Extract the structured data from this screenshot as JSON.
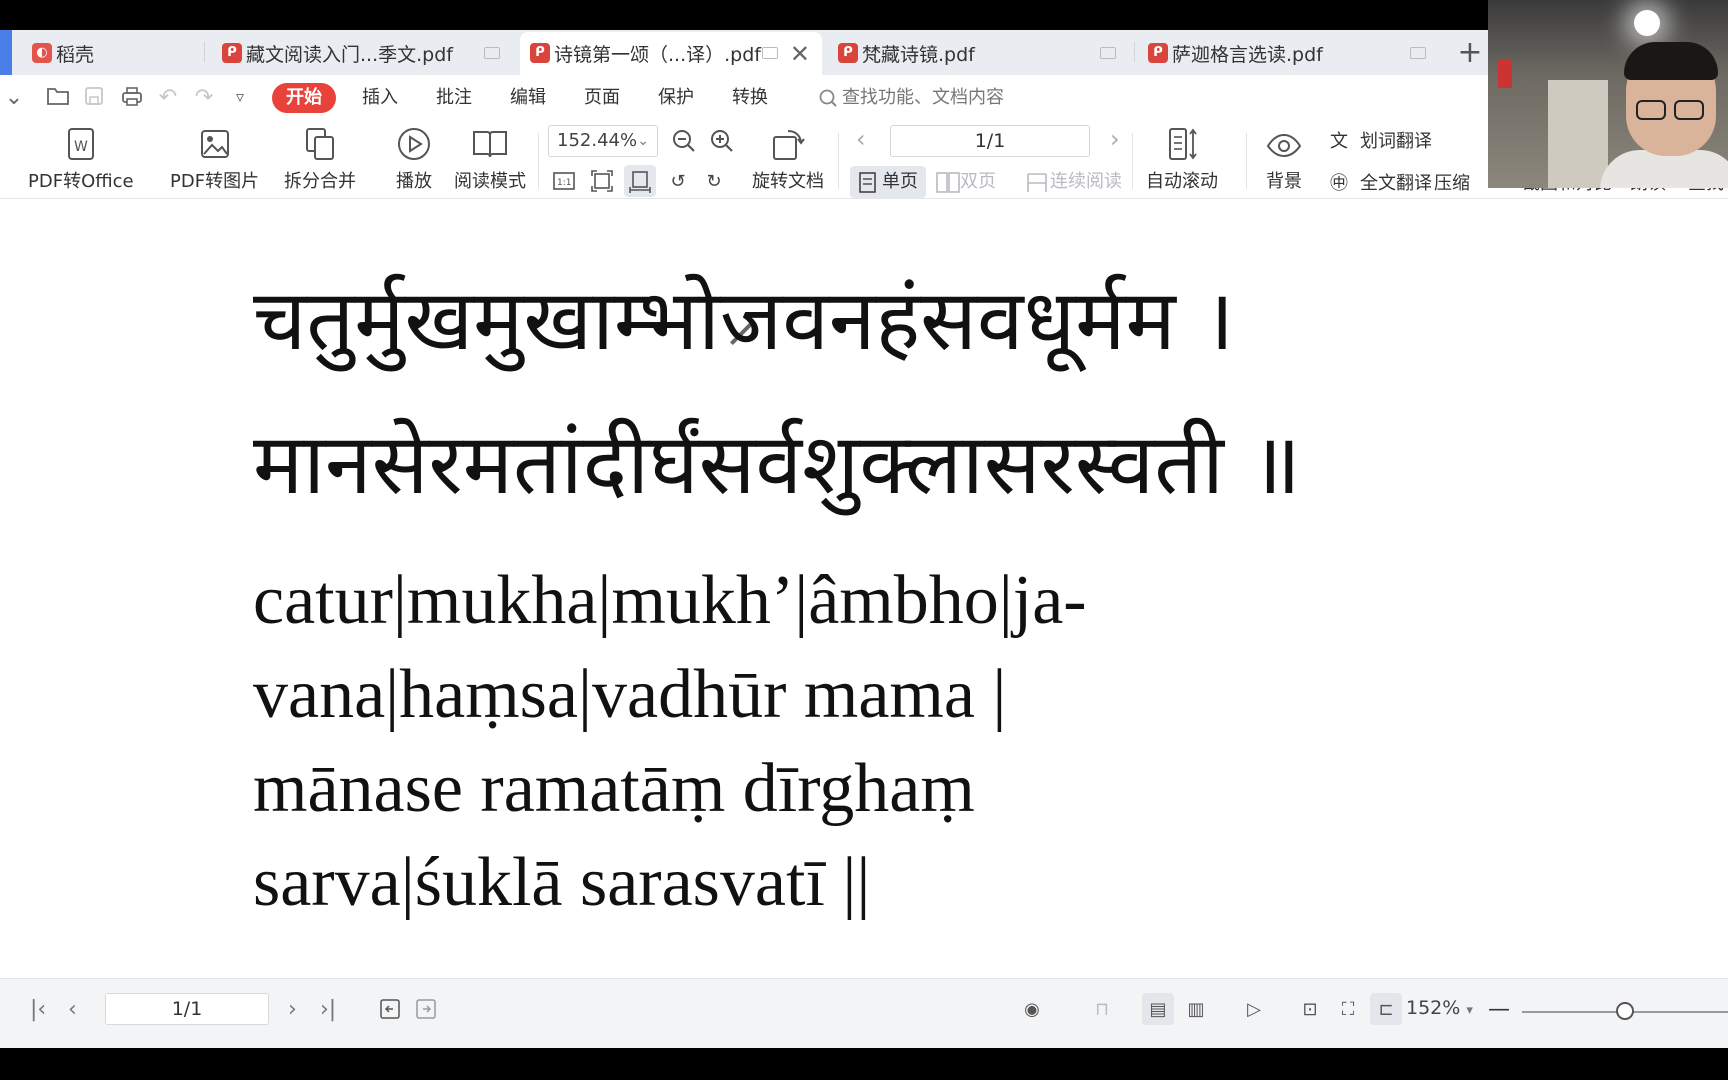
{
  "tabs": [
    {
      "label": "稻壳",
      "kind": "home"
    },
    {
      "label": "藏文阅读入门...季文.pdf",
      "kind": "pdf"
    },
    {
      "label": "诗镜第一颂（...译）.pdf",
      "kind": "pdf",
      "active": true
    },
    {
      "label": "梵藏诗镜.pdf",
      "kind": "pdf"
    },
    {
      "label": "萨迦格言选读.pdf",
      "kind": "pdf"
    }
  ],
  "new_tab": "+",
  "menu": {
    "items": [
      "开始",
      "插入",
      "批注",
      "编辑",
      "页面",
      "保护",
      "转换"
    ],
    "active": "开始",
    "search_placeholder": "查找功能、文档内容"
  },
  "toolbar": {
    "pdf_to_office": "PDF转Office",
    "pdf_to_image": "PDF转图片",
    "split_merge": "拆分合并",
    "play": "播放",
    "read_mode": "阅读模式",
    "zoom_value": "152.44%",
    "rotate_doc": "旋转文档",
    "page_value": "1/1",
    "single_page": "单页",
    "double_page": "双页",
    "continuous": "连续阅读",
    "auto_scroll": "自动滚动",
    "background": "背景",
    "word_translate": "划词翻译",
    "full_translate": "全文翻译",
    "compress": "压缩",
    "screenshot_compare": "截图和对比",
    "read_aloud": "朗读",
    "find": "查找"
  },
  "document": {
    "devanagari_line1": "चतुर्मुखमुखाम्भोजवनहंसवधूर्मम ।",
    "devanagari_line2": "मानसेरमतांदीर्घंसर्वशुक्लासरस्वती ॥",
    "roman_line1": "catur|mukha|mukh’|âmbho|ja-",
    "roman_line2": "vana|haṃsa|vadhūr mama |",
    "roman_line3": "mānase ramatāṃ dīrghaṃ",
    "roman_line4": "sarva|śuklā sarasvatī ||"
  },
  "statusbar": {
    "page_value": "1/1",
    "zoom_value": "152%",
    "zoom_slider_fraction": 0.5
  },
  "colors": {
    "accent_red": "#e9423a",
    "tab_bar_bg": "#e9ecf1"
  }
}
